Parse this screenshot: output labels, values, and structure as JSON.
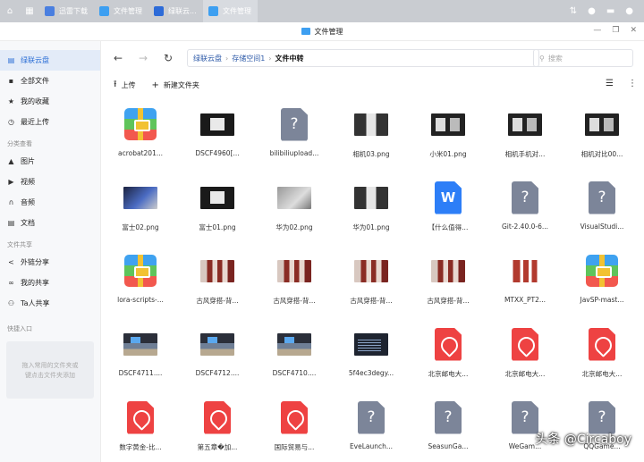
{
  "taskbar": {
    "tabs": [
      {
        "label": "迅雷下载",
        "color": "#4a7fe0"
      },
      {
        "label": "文件管理",
        "color": "#3d9ff1"
      },
      {
        "label": "绿联云...",
        "color": "#2d6bd8"
      },
      {
        "label": "文件管理",
        "color": "#3d9ff1"
      }
    ]
  },
  "window": {
    "title": "文件管理"
  },
  "sidebar": {
    "items": [
      {
        "label": "绿联云盘",
        "icon": "cloud-icon",
        "active": true
      },
      {
        "label": "全部文件",
        "icon": "folder-icon"
      },
      {
        "label": "我的收藏",
        "icon": "star-icon"
      },
      {
        "label": "最近上传",
        "icon": "clock-icon"
      }
    ],
    "section_category": "分类查看",
    "category_items": [
      {
        "label": "图片",
        "icon": "image-icon"
      },
      {
        "label": "视频",
        "icon": "video-icon"
      },
      {
        "label": "音频",
        "icon": "headphones-icon"
      },
      {
        "label": "文档",
        "icon": "document-icon"
      }
    ],
    "section_share": "文件共享",
    "share_items": [
      {
        "label": "外链分享",
        "icon": "share-icon"
      },
      {
        "label": "我的共享",
        "icon": "link-icon"
      },
      {
        "label": "Ta人共享",
        "icon": "user-share-icon"
      }
    ],
    "section_quick": "快捷入口",
    "quick_hint_1": "拖入常用的文件夹或",
    "quick_hint_2": "键点击文件夹添加"
  },
  "nav": {
    "breadcrumb": [
      "绿联云盘",
      "存储空间1",
      "文件中转"
    ],
    "search_placeholder": "搜索"
  },
  "toolbar": {
    "upload_label": "上传",
    "new_folder_label": "新建文件夹"
  },
  "files": [
    {
      "name": "acrobat201...",
      "kind": "pkg"
    },
    {
      "name": "DSCF4960[...",
      "kind": "img",
      "style": "i-dark",
      "orient": "land"
    },
    {
      "name": "bilibiliupload...",
      "kind": "unk"
    },
    {
      "name": "相机03.png",
      "kind": "img",
      "style": "i-phone",
      "orient": "land"
    },
    {
      "name": "小米01.png",
      "kind": "img",
      "style": "i-dark2",
      "orient": "land"
    },
    {
      "name": "相机手机对...",
      "kind": "img",
      "style": "i-dark2",
      "orient": "land"
    },
    {
      "name": "相机对比00...",
      "kind": "img",
      "style": "i-dark2",
      "orient": "land"
    },
    {
      "name": "富士02.png",
      "kind": "img",
      "style": "i-blue",
      "orient": "land"
    },
    {
      "name": "富士01.png",
      "kind": "img",
      "style": "i-dark",
      "orient": "land"
    },
    {
      "name": "华为02.png",
      "kind": "img",
      "style": "i-gray",
      "orient": "land"
    },
    {
      "name": "华为01.png",
      "kind": "img",
      "style": "i-phone",
      "orient": "land"
    },
    {
      "name": "【什么值得...",
      "kind": "word"
    },
    {
      "name": "Git-2.40.0-6...",
      "kind": "unk"
    },
    {
      "name": "VisualStudi...",
      "kind": "unk"
    },
    {
      "name": "lora-scripts-...",
      "kind": "pkg"
    },
    {
      "name": "古风穿搭-背...",
      "kind": "img",
      "style": "i-girls",
      "orient": "land"
    },
    {
      "name": "古风穿搭-背...",
      "kind": "img",
      "style": "i-girls",
      "orient": "land"
    },
    {
      "name": "古风穿搭-背...",
      "kind": "img",
      "style": "i-girls",
      "orient": "land"
    },
    {
      "name": "古风穿搭-背...",
      "kind": "img",
      "style": "i-girls",
      "orient": "land"
    },
    {
      "name": "MTXX_PT2...",
      "kind": "img",
      "style": "i-mtxx",
      "orient": "land"
    },
    {
      "name": "JavSP-mast...",
      "kind": "pkg"
    },
    {
      "name": "DSCF4711....",
      "kind": "img",
      "style": "i-office",
      "orient": "land"
    },
    {
      "name": "DSCF4712....",
      "kind": "img",
      "style": "i-office",
      "orient": "land"
    },
    {
      "name": "DSCF4710....",
      "kind": "img",
      "style": "i-office",
      "orient": "land"
    },
    {
      "name": "5f4ec3degy...",
      "kind": "img",
      "style": "i-code",
      "orient": "land"
    },
    {
      "name": "北京邮电大...",
      "kind": "pdf"
    },
    {
      "name": "北京邮电大...",
      "kind": "pdf"
    },
    {
      "name": "北京邮电大...",
      "kind": "pdf"
    },
    {
      "name": "数字黄金-比...",
      "kind": "pdf"
    },
    {
      "name": "第五章�加...",
      "kind": "pdf"
    },
    {
      "name": "国际贸易与...",
      "kind": "pdf"
    },
    {
      "name": "EveLaunch...",
      "kind": "unk"
    },
    {
      "name": "SeasunGa...",
      "kind": "unk"
    },
    {
      "name": "WeGam...",
      "kind": "unk"
    },
    {
      "name": "QQGame...",
      "kind": "unk"
    }
  ],
  "watermark": "头条 @Circaboy"
}
